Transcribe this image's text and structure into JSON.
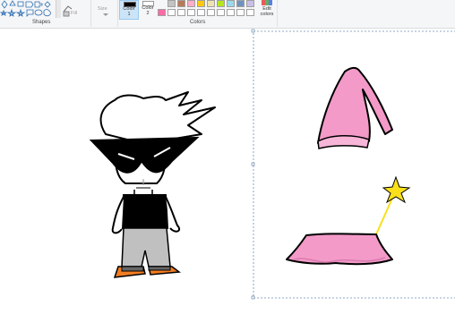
{
  "ribbon": {
    "shapes": {
      "group_label": "Shapes",
      "fill_label": "Fill"
    },
    "size": {
      "label": "Size"
    },
    "color1": {
      "label": "Color 1",
      "color": "#000000"
    },
    "color2": {
      "label": "Color 2",
      "color": "#ffffff"
    },
    "colors": {
      "group_label": "Colors",
      "palette_row1": [
        "#c3c3c3",
        "#b97a57",
        "#ffaec9",
        "#ffc90e",
        "#efe4b0",
        "#b5e61d",
        "#99d9ea",
        "#7092be",
        "#c8bfe7"
      ],
      "palette_row2": [
        "#ffffff",
        "#ffffff",
        "#ffffff",
        "#ffffff",
        "#ffffff",
        "#ffffff",
        "#ffffff",
        "#ffffff",
        "#ffffff"
      ],
      "custom_color": "#ff6aa6"
    },
    "edit_colors": {
      "label_line1": "Edit",
      "label_line2": "colors"
    }
  },
  "canvas": {
    "background": "#ffffff",
    "accent_pink": "#f39ac8",
    "pink_light": "#f7b5d8",
    "star_color": "#f9e01b",
    "shoe_color": "#f07d22",
    "pants_color": "#c0c0c0"
  }
}
